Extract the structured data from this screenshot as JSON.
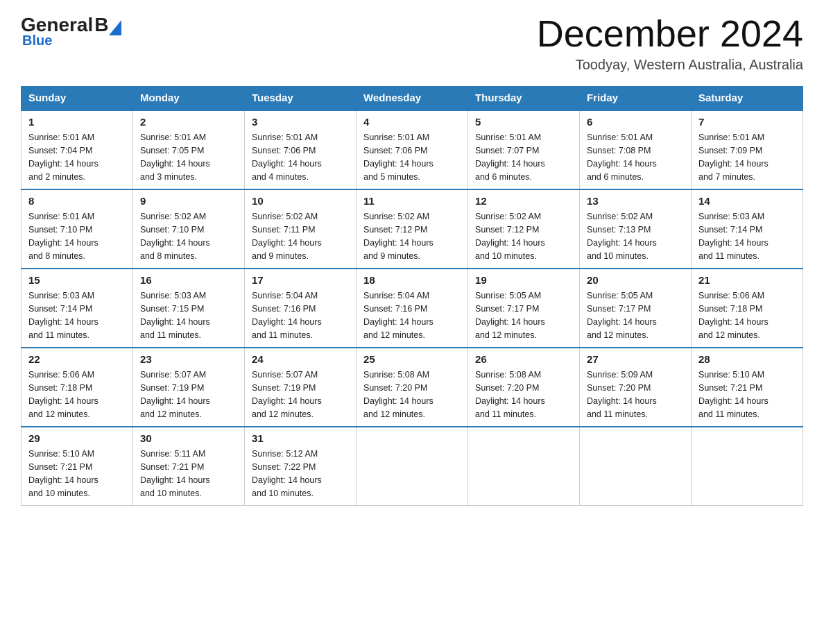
{
  "header": {
    "logo_general": "General",
    "logo_blue": "Blue",
    "month_title": "December 2024",
    "location": "Toodyay, Western Australia, Australia"
  },
  "days_of_week": [
    "Sunday",
    "Monday",
    "Tuesday",
    "Wednesday",
    "Thursday",
    "Friday",
    "Saturday"
  ],
  "weeks": [
    [
      {
        "day": "1",
        "sunrise": "5:01 AM",
        "sunset": "7:04 PM",
        "daylight": "14 hours and 2 minutes."
      },
      {
        "day": "2",
        "sunrise": "5:01 AM",
        "sunset": "7:05 PM",
        "daylight": "14 hours and 3 minutes."
      },
      {
        "day": "3",
        "sunrise": "5:01 AM",
        "sunset": "7:06 PM",
        "daylight": "14 hours and 4 minutes."
      },
      {
        "day": "4",
        "sunrise": "5:01 AM",
        "sunset": "7:06 PM",
        "daylight": "14 hours and 5 minutes."
      },
      {
        "day": "5",
        "sunrise": "5:01 AM",
        "sunset": "7:07 PM",
        "daylight": "14 hours and 6 minutes."
      },
      {
        "day": "6",
        "sunrise": "5:01 AM",
        "sunset": "7:08 PM",
        "daylight": "14 hours and 6 minutes."
      },
      {
        "day": "7",
        "sunrise": "5:01 AM",
        "sunset": "7:09 PM",
        "daylight": "14 hours and 7 minutes."
      }
    ],
    [
      {
        "day": "8",
        "sunrise": "5:01 AM",
        "sunset": "7:10 PM",
        "daylight": "14 hours and 8 minutes."
      },
      {
        "day": "9",
        "sunrise": "5:02 AM",
        "sunset": "7:10 PM",
        "daylight": "14 hours and 8 minutes."
      },
      {
        "day": "10",
        "sunrise": "5:02 AM",
        "sunset": "7:11 PM",
        "daylight": "14 hours and 9 minutes."
      },
      {
        "day": "11",
        "sunrise": "5:02 AM",
        "sunset": "7:12 PM",
        "daylight": "14 hours and 9 minutes."
      },
      {
        "day": "12",
        "sunrise": "5:02 AM",
        "sunset": "7:12 PM",
        "daylight": "14 hours and 10 minutes."
      },
      {
        "day": "13",
        "sunrise": "5:02 AM",
        "sunset": "7:13 PM",
        "daylight": "14 hours and 10 minutes."
      },
      {
        "day": "14",
        "sunrise": "5:03 AM",
        "sunset": "7:14 PM",
        "daylight": "14 hours and 11 minutes."
      }
    ],
    [
      {
        "day": "15",
        "sunrise": "5:03 AM",
        "sunset": "7:14 PM",
        "daylight": "14 hours and 11 minutes."
      },
      {
        "day": "16",
        "sunrise": "5:03 AM",
        "sunset": "7:15 PM",
        "daylight": "14 hours and 11 minutes."
      },
      {
        "day": "17",
        "sunrise": "5:04 AM",
        "sunset": "7:16 PM",
        "daylight": "14 hours and 11 minutes."
      },
      {
        "day": "18",
        "sunrise": "5:04 AM",
        "sunset": "7:16 PM",
        "daylight": "14 hours and 12 minutes."
      },
      {
        "day": "19",
        "sunrise": "5:05 AM",
        "sunset": "7:17 PM",
        "daylight": "14 hours and 12 minutes."
      },
      {
        "day": "20",
        "sunrise": "5:05 AM",
        "sunset": "7:17 PM",
        "daylight": "14 hours and 12 minutes."
      },
      {
        "day": "21",
        "sunrise": "5:06 AM",
        "sunset": "7:18 PM",
        "daylight": "14 hours and 12 minutes."
      }
    ],
    [
      {
        "day": "22",
        "sunrise": "5:06 AM",
        "sunset": "7:18 PM",
        "daylight": "14 hours and 12 minutes."
      },
      {
        "day": "23",
        "sunrise": "5:07 AM",
        "sunset": "7:19 PM",
        "daylight": "14 hours and 12 minutes."
      },
      {
        "day": "24",
        "sunrise": "5:07 AM",
        "sunset": "7:19 PM",
        "daylight": "14 hours and 12 minutes."
      },
      {
        "day": "25",
        "sunrise": "5:08 AM",
        "sunset": "7:20 PM",
        "daylight": "14 hours and 12 minutes."
      },
      {
        "day": "26",
        "sunrise": "5:08 AM",
        "sunset": "7:20 PM",
        "daylight": "14 hours and 11 minutes."
      },
      {
        "day": "27",
        "sunrise": "5:09 AM",
        "sunset": "7:20 PM",
        "daylight": "14 hours and 11 minutes."
      },
      {
        "day": "28",
        "sunrise": "5:10 AM",
        "sunset": "7:21 PM",
        "daylight": "14 hours and 11 minutes."
      }
    ],
    [
      {
        "day": "29",
        "sunrise": "5:10 AM",
        "sunset": "7:21 PM",
        "daylight": "14 hours and 10 minutes."
      },
      {
        "day": "30",
        "sunrise": "5:11 AM",
        "sunset": "7:21 PM",
        "daylight": "14 hours and 10 minutes."
      },
      {
        "day": "31",
        "sunrise": "5:12 AM",
        "sunset": "7:22 PM",
        "daylight": "14 hours and 10 minutes."
      },
      null,
      null,
      null,
      null
    ]
  ],
  "labels": {
    "sunrise": "Sunrise:",
    "sunset": "Sunset:",
    "daylight": "Daylight:"
  }
}
